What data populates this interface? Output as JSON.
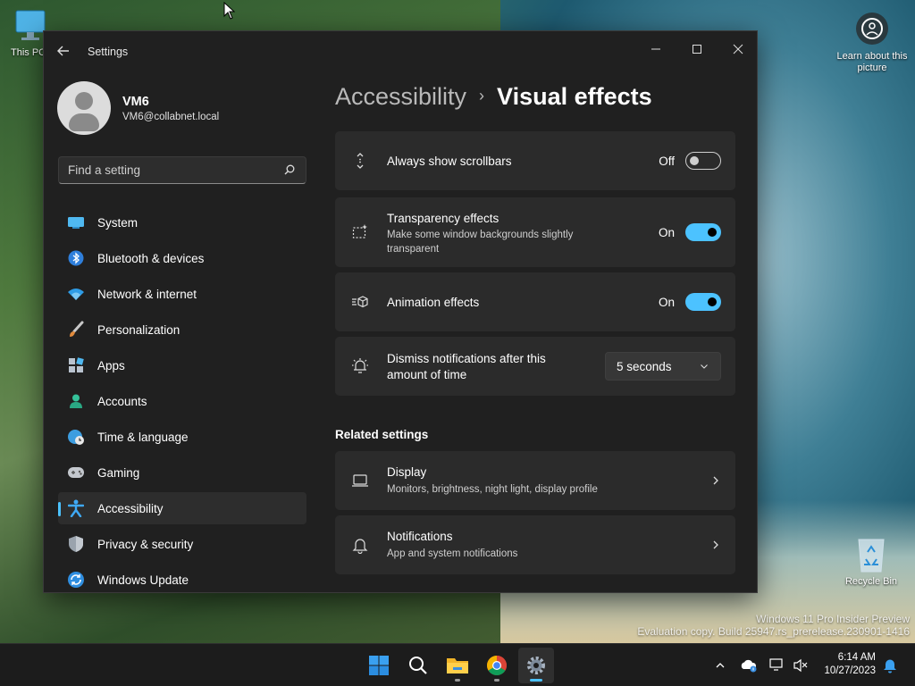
{
  "desktop": {
    "icons": [
      {
        "label": "This PC"
      },
      {
        "label": "Recycle Bin"
      }
    ],
    "learn_picture": "Learn about this picture",
    "watermark_line1": "Windows 11 Pro Insider Preview",
    "watermark_line2": "Evaluation copy. Build 25947.rs_prerelease.230901-1416"
  },
  "window": {
    "title": "Settings",
    "user": {
      "name": "VM6",
      "email": "VM6@collabnet.local"
    },
    "search_placeholder": "Find a setting",
    "nav": [
      {
        "label": "System",
        "icon": "system-icon"
      },
      {
        "label": "Bluetooth & devices",
        "icon": "bluetooth-icon"
      },
      {
        "label": "Network & internet",
        "icon": "wifi-icon"
      },
      {
        "label": "Personalization",
        "icon": "brush-icon"
      },
      {
        "label": "Apps",
        "icon": "apps-icon"
      },
      {
        "label": "Accounts",
        "icon": "accounts-icon"
      },
      {
        "label": "Time & language",
        "icon": "globe-clock-icon"
      },
      {
        "label": "Gaming",
        "icon": "gamepad-icon"
      },
      {
        "label": "Accessibility",
        "icon": "accessibility-icon",
        "active": true
      },
      {
        "label": "Privacy & security",
        "icon": "shield-icon"
      },
      {
        "label": "Windows Update",
        "icon": "update-icon"
      }
    ],
    "breadcrumb": {
      "parent": "Accessibility",
      "separator": "›",
      "current": "Visual effects"
    },
    "settings": [
      {
        "title": "Always show scrollbars",
        "state": "Off",
        "on": false
      },
      {
        "title": "Transparency effects",
        "subtitle": "Make some window backgrounds slightly transparent",
        "state": "On",
        "on": true
      },
      {
        "title": "Animation effects",
        "state": "On",
        "on": true
      },
      {
        "title": "Dismiss notifications after this amount of time",
        "value": "5 seconds"
      }
    ],
    "related_heading": "Related settings",
    "related": [
      {
        "title": "Display",
        "subtitle": "Monitors, brightness, night light, display profile"
      },
      {
        "title": "Notifications",
        "subtitle": "App and system notifications"
      }
    ]
  },
  "taskbar": {
    "clock_time": "6:14 AM",
    "clock_date": "10/27/2023"
  },
  "colors": {
    "accent": "#4cc2ff",
    "window_bg": "#202020",
    "card_bg": "#2b2b2b"
  }
}
